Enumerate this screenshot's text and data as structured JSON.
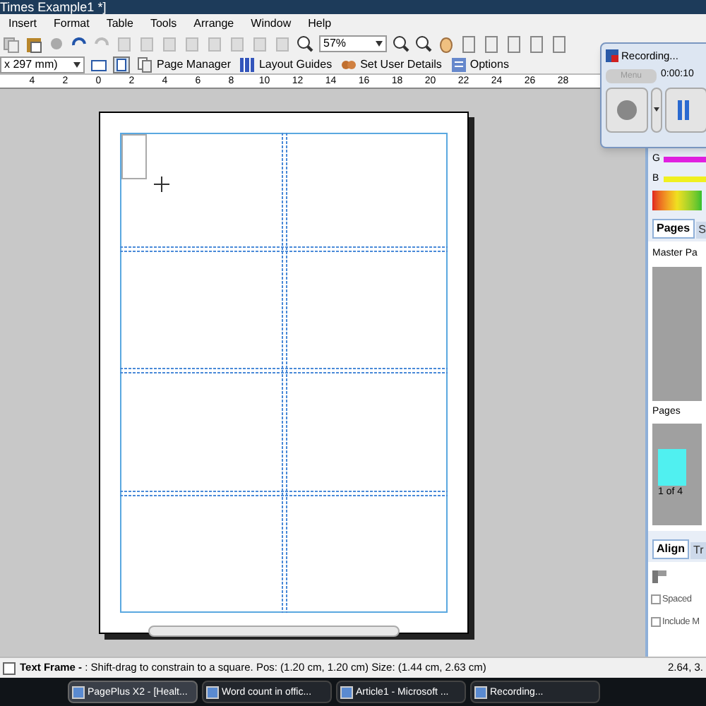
{
  "window": {
    "title": "Times Example1 *]"
  },
  "menu": [
    "Insert",
    "Format",
    "Table",
    "Tools",
    "Arrange",
    "Window",
    "Help"
  ],
  "toolbar": {
    "zoom": "57%"
  },
  "context_toolbar": {
    "page_size": "x 297 mm)",
    "buttons": [
      {
        "label": "Page Manager",
        "kind": "pages"
      },
      {
        "label": "Layout Guides",
        "kind": "guides"
      },
      {
        "label": "Set User Details",
        "kind": "user"
      },
      {
        "label": "Options",
        "kind": "options"
      }
    ]
  },
  "ruler": {
    "ticks": [
      "4",
      "2",
      "0",
      "2",
      "4",
      "6",
      "8",
      "10",
      "12",
      "14",
      "16",
      "18",
      "20",
      "22",
      "24",
      "26",
      "28"
    ]
  },
  "recording": {
    "title": "Recording...",
    "menu": "Menu",
    "time": "0:00:10"
  },
  "color_panel": {
    "labels": [
      "G",
      "B"
    ]
  },
  "pages_panel": {
    "tabs": [
      {
        "label": "Pages",
        "selected": true
      },
      {
        "label": "S",
        "selected": false
      }
    ],
    "master_label": "Master Pa",
    "pages_label": "Pages",
    "page_count": "1 of 4"
  },
  "align_panel": {
    "tabs": [
      {
        "label": "Align",
        "selected": true
      },
      {
        "label": "Tr",
        "selected": false
      }
    ],
    "options": [
      {
        "label": "Spaced",
        "checked": false
      },
      {
        "label": "Include M",
        "checked": false
      }
    ]
  },
  "status_bar": {
    "label": "Text Frame - ",
    "message": ": Shift-drag to constrain to a square. Pos: (1.20 cm, 1.20 cm)  Size: (1.44 cm, 2.63 cm)",
    "coords": "2.64, 3."
  },
  "taskbar": [
    {
      "label": "PagePlus X2 - [Healt...",
      "selected": true
    },
    {
      "label": "Word count in offic...",
      "selected": false
    },
    {
      "label": "Article1 - Microsoft ...",
      "selected": false
    },
    {
      "label": "Recording...",
      "selected": false
    }
  ]
}
